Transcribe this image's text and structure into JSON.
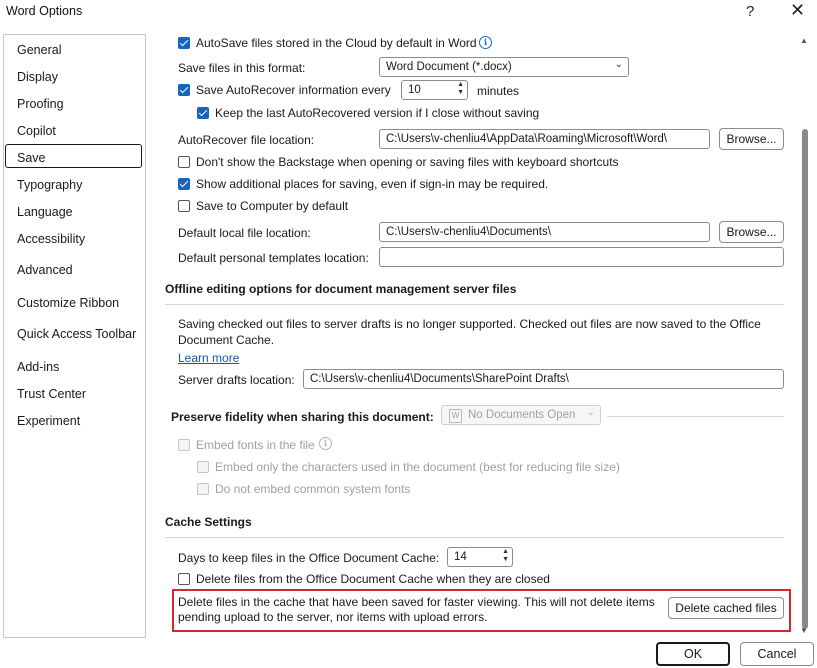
{
  "window": {
    "title": "Word Options",
    "help_label": "?",
    "close_label": "✕"
  },
  "sidebar": {
    "items": [
      {
        "label": "General"
      },
      {
        "label": "Display"
      },
      {
        "label": "Proofing"
      },
      {
        "label": "Copilot"
      },
      {
        "label": "Save",
        "selected": true
      },
      {
        "label": "Typography"
      },
      {
        "label": "Language"
      },
      {
        "label": "Accessibility"
      },
      {
        "label": "Advanced"
      },
      {
        "label": "Customize Ribbon"
      },
      {
        "label": "Quick Access Toolbar"
      },
      {
        "label": "Add-ins"
      },
      {
        "label": "Trust Center"
      },
      {
        "label": "Experiment"
      }
    ]
  },
  "save": {
    "autosave_label": "AutoSave files stored in the Cloud by default in Word",
    "autosave_checked": true,
    "format_label": "Save files in this format:",
    "format_value": "Word Document (*.docx)",
    "autorecover_label": "Save AutoRecover information every",
    "autorecover_checked": true,
    "autorecover_minutes": "10",
    "minutes_label": "minutes",
    "keep_last_label": "Keep the last AutoRecovered version if I close without saving",
    "keep_last_checked": true,
    "autorecover_location_label": "AutoRecover file location:",
    "autorecover_location_value": "C:\\Users\\v-chenliu4\\AppData\\Roaming\\Microsoft\\Word\\",
    "browse_label": "Browse...",
    "backstage_label": "Don't show the Backstage when opening or saving files with keyboard shortcuts",
    "backstage_checked": false,
    "additional_places_label": "Show additional places for saving, even if sign-in may be required.",
    "additional_places_checked": true,
    "save_to_computer_label": "Save to Computer by default",
    "save_to_computer_checked": false,
    "default_local_label": "Default local file location:",
    "default_local_value": "C:\\Users\\v-chenliu4\\Documents\\",
    "templates_label": "Default personal templates location:",
    "templates_value": ""
  },
  "offline": {
    "heading": "Offline editing options for document management server files",
    "notice": "Saving checked out files to server drafts is no longer supported. Checked out files are now saved to the Office Document Cache.",
    "learn_more": "Learn more",
    "server_drafts_label": "Server drafts location:",
    "server_drafts_value": "C:\\Users\\v-chenliu4\\Documents\\SharePoint Drafts\\"
  },
  "fidelity": {
    "heading": "Preserve fidelity when sharing this document:",
    "document_select": "No Documents Open",
    "embed_fonts_label": "Embed fonts in the file",
    "embed_chars_label": "Embed only the characters used in the document (best for reducing file size)",
    "no_common_label": "Do not embed common system fonts"
  },
  "cache": {
    "heading": "Cache Settings",
    "days_label": "Days to keep files in the Office Document Cache:",
    "days_value": "14",
    "delete_closed_label": "Delete files from the Office Document Cache when they are closed",
    "delete_closed_checked": false,
    "delete_info": "Delete files in the cache that have been saved for faster viewing. This will not delete items pending upload to the server, nor items with upload errors.",
    "delete_button": "Delete cached files"
  },
  "footer": {
    "ok": "OK",
    "cancel": "Cancel"
  },
  "colors": {
    "accent": "#1565c0",
    "highlight": "#d9252d",
    "link": "#0b5cad"
  }
}
